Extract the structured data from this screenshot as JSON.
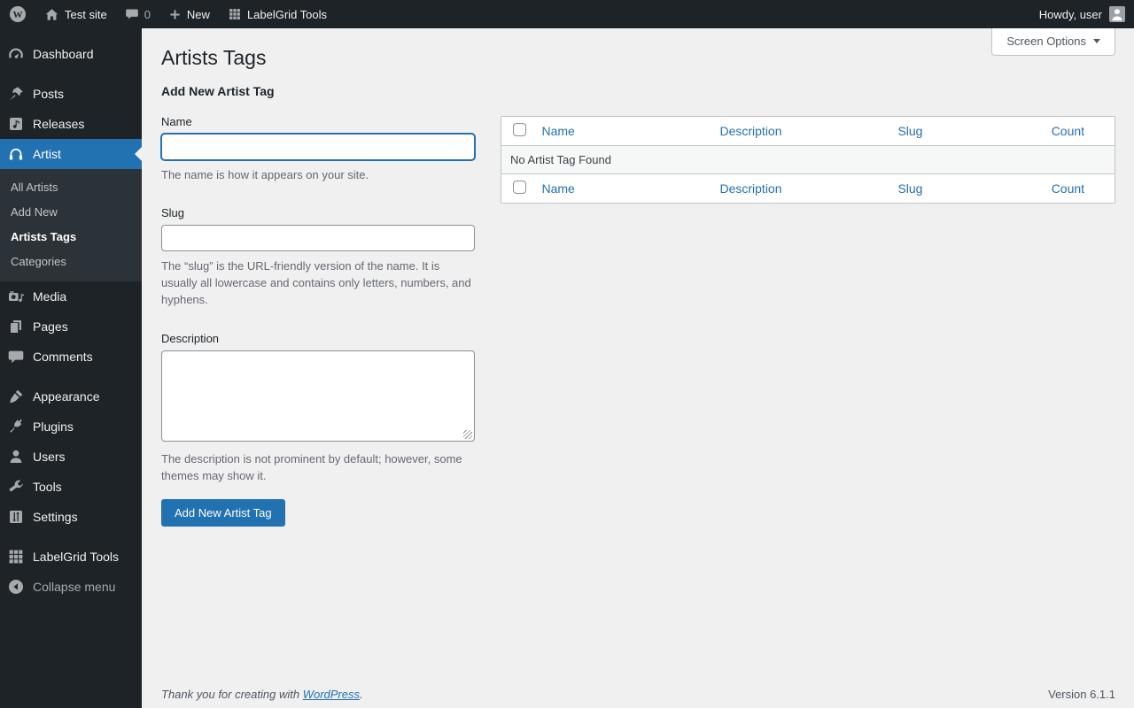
{
  "admin_bar": {
    "site_name": "Test site",
    "comment_count": "0",
    "new_label": "New",
    "labelgrid_label": "LabelGrid Tools",
    "howdy": "Howdy, user"
  },
  "sidebar": {
    "items": [
      {
        "label": "Dashboard"
      },
      {
        "label": "Posts"
      },
      {
        "label": "Releases"
      },
      {
        "label": "Artist",
        "active": true
      },
      {
        "label": "Media"
      },
      {
        "label": "Pages"
      },
      {
        "label": "Comments"
      },
      {
        "label": "Appearance"
      },
      {
        "label": "Plugins"
      },
      {
        "label": "Users"
      },
      {
        "label": "Tools"
      },
      {
        "label": "Settings"
      },
      {
        "label": "LabelGrid Tools"
      },
      {
        "label": "Collapse menu"
      }
    ],
    "submenu": [
      "All Artists",
      "Add New",
      "Artists Tags",
      "Categories"
    ]
  },
  "main": {
    "page_title": "Artists Tags",
    "screen_options_label": "Screen Options",
    "form": {
      "heading": "Add New Artist Tag",
      "name_label": "Name",
      "name_value": "",
      "name_help": "The name is how it appears on your site.",
      "slug_label": "Slug",
      "slug_value": "",
      "slug_help": "The “slug” is the URL-friendly version of the name. It is usually all lowercase and contains only letters, numbers, and hyphens.",
      "description_label": "Description",
      "description_value": "",
      "description_help": "The description is not prominent by default; however, some themes may show it.",
      "submit_label": "Add New Artist Tag"
    },
    "table": {
      "columns": [
        "Name",
        "Description",
        "Slug",
        "Count"
      ],
      "empty_message": "No Artist Tag Found"
    },
    "footer": {
      "thanks_prefix": "Thank you for creating with ",
      "wordpress_link": "WordPress",
      "thanks_suffix": ".",
      "version": "Version 6.1.1"
    }
  },
  "colors": {
    "accent": "#2271b1",
    "dark_bg": "#1d2327",
    "submenu_bg": "#2c3338",
    "content_bg": "#f0f0f1"
  }
}
